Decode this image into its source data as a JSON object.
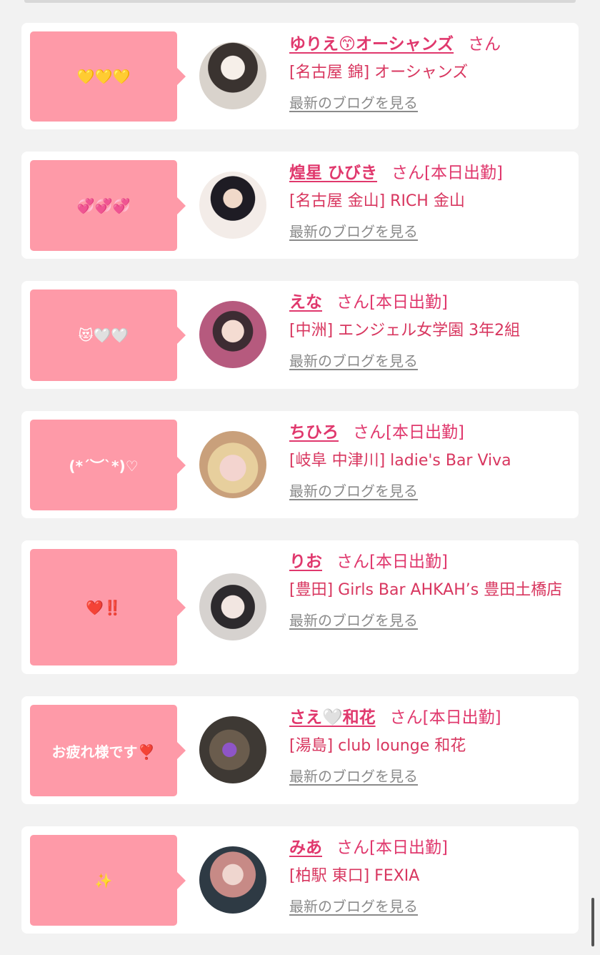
{
  "posts": [
    {
      "message": "💛💛💛",
      "name": "ゆりえ😙オーシャンズ",
      "san": "さん",
      "status": "",
      "shop": "[名古屋 錦] オーシャンズ",
      "blog_link": "最新のブログを見る",
      "avatar_bg": "#d9d3cc"
    },
    {
      "message": "💞💞💞",
      "name": "煌星 ひびき",
      "san": "さん",
      "status": "[本日出勤]",
      "shop": "[名古屋 金山] RICH 金山",
      "blog_link": "最新のブログを見る",
      "avatar_bg": "#f3ece8"
    },
    {
      "message": "😻🤍🤍",
      "name": "えな",
      "san": "さん",
      "status": "[本日出勤]",
      "shop": "[中洲] エンジェル女学園 3年2組",
      "blog_link": "最新のブログを見る",
      "avatar_bg": "#b65a7e"
    },
    {
      "message": "(*´︶`*)♡",
      "name": "ちひろ",
      "san": "さん",
      "status": "[本日出勤]",
      "shop": "[岐阜 中津川] ladie's Bar Viva",
      "blog_link": "最新のブログを見る",
      "avatar_bg": "#c9a07b"
    },
    {
      "message": "❤️‼️",
      "name": "りお",
      "san": "さん",
      "status": "[本日出勤]",
      "shop": "[豊田] Girls Bar AHKAH’s 豊田土橋店",
      "blog_link": "最新のブログを見る",
      "avatar_bg": "#d6d2cf"
    },
    {
      "message": "お疲れ様です❣️",
      "name": "さえ🤍和花",
      "san": "さん",
      "status": "[本日出勤]",
      "shop": "[湯島] club lounge 和花",
      "blog_link": "最新のブログを見る",
      "avatar_bg": "#3e3934"
    },
    {
      "message": "✨",
      "name": "みあ",
      "san": "さん",
      "status": "[本日出勤]",
      "shop": "[柏駅 東口] FEXIA",
      "blog_link": "最新のブログを見る",
      "avatar_bg": "#2e3a44"
    }
  ],
  "colors": {
    "accent": "#e0386d",
    "bubble": "#fe9aa8",
    "link": "#8a8a8a"
  }
}
